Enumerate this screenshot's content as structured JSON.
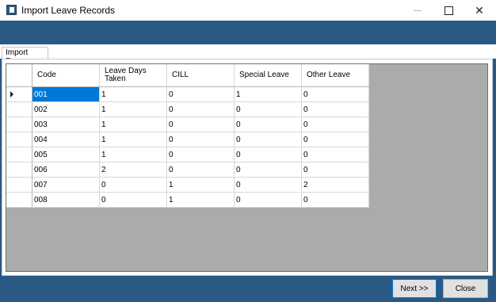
{
  "window": {
    "title": "Import Leave Records",
    "minimize_glyph": "—",
    "close_glyph": "✕"
  },
  "tabs": [
    {
      "label": "Import Rows"
    }
  ],
  "grid": {
    "columns": [
      "Code",
      "Leave Days Taken",
      "CILL",
      "Special Leave",
      "Other Leave"
    ],
    "selected_row": 0,
    "rows": [
      [
        "001",
        "1",
        "0",
        "1",
        "0"
      ],
      [
        "002",
        "1",
        "0",
        "0",
        "0"
      ],
      [
        "003",
        "1",
        "0",
        "0",
        "0"
      ],
      [
        "004",
        "1",
        "0",
        "0",
        "0"
      ],
      [
        "005",
        "1",
        "0",
        "0",
        "0"
      ],
      [
        "006",
        "2",
        "0",
        "0",
        "0"
      ],
      [
        "007",
        "0",
        "1",
        "0",
        "2"
      ],
      [
        "008",
        "0",
        "1",
        "0",
        "0"
      ]
    ]
  },
  "buttons": {
    "next": "Next >>",
    "close": "Close"
  },
  "colors": {
    "banner": "#2a5984",
    "selection": "#0078d7",
    "grid_background": "#ababab"
  }
}
